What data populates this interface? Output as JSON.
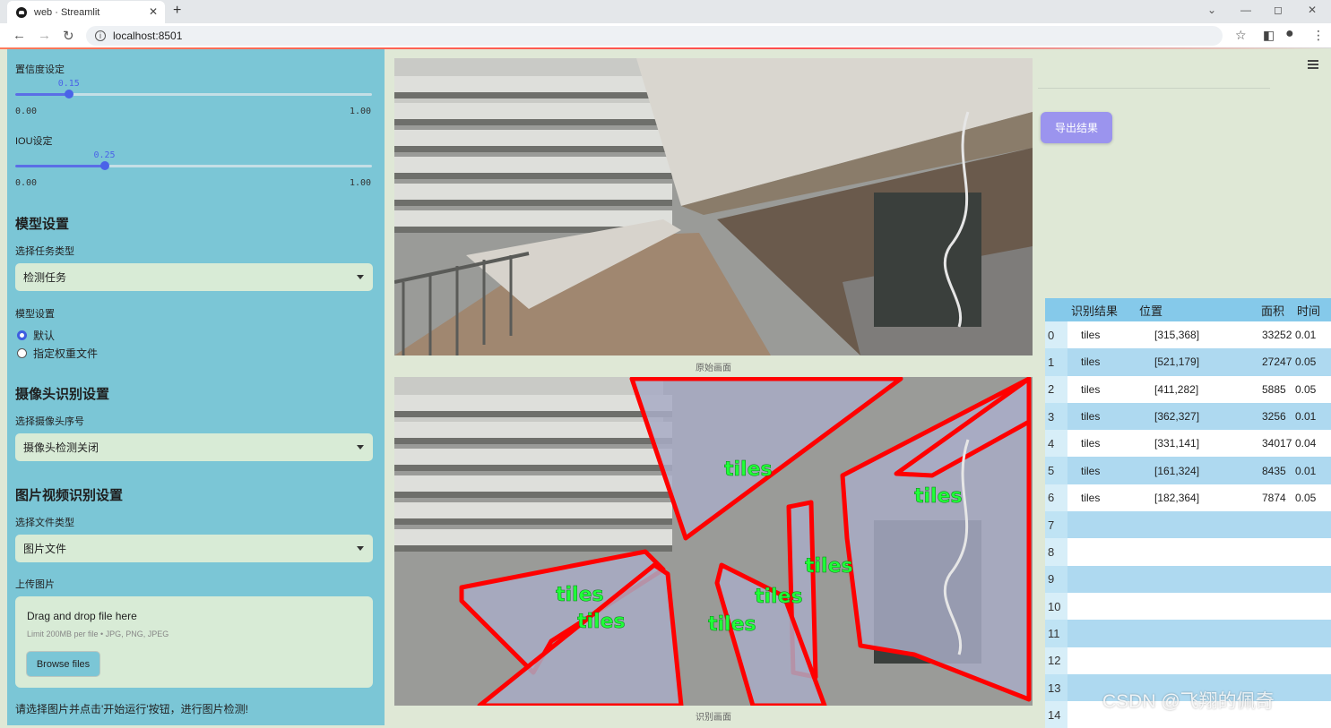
{
  "browser": {
    "tab_title": "web · Streamlit",
    "tab_close": "✕",
    "new_tab": "+",
    "url": "localhost:8501",
    "win_min": "—",
    "win_max": "◻",
    "win_close": "✕"
  },
  "sidebar": {
    "conf_label": "置信度设定",
    "conf_value": "0.15",
    "conf_fraction": 0.15,
    "conf_min": "0.00",
    "conf_max": "1.00",
    "iou_label": "IOU设定",
    "iou_value": "0.25",
    "iou_fraction": 0.25,
    "iou_min": "0.00",
    "iou_max": "1.00",
    "model_header": "模型设置",
    "task_type_label": "选择任务类型",
    "task_type_value": "检测任务",
    "model_setting_label": "模型设置",
    "radio_default": "默认",
    "radio_custom": "指定权重文件",
    "camera_header": "摄像头识别设置",
    "camera_label": "选择摄像头序号",
    "camera_value": "摄像头检测关闭",
    "media_header": "图片视频识别设置",
    "file_type_label": "选择文件类型",
    "file_type_value": "图片文件",
    "upload_label": "上传图片",
    "upload_drag": "Drag and drop file here",
    "upload_limit": "Limit 200MB per file • JPG, PNG, JPEG",
    "upload_button": "Browse files",
    "footer_hint": "请选择图片并点击'开始运行'按钮，进行图片检测!"
  },
  "main": {
    "caption_original": "原始画面",
    "caption_detected": "识别画面",
    "export_button": "导出结果",
    "detection_label": "tiles",
    "watermark": "CSDN @飞翔的佩奇"
  },
  "table": {
    "headers": [
      "",
      "识别结果",
      "位置",
      "面积",
      "时间"
    ],
    "rows": [
      {
        "idx": "0",
        "label": "tiles",
        "pos": "[315,368]",
        "area": "33252",
        "time": "0.01"
      },
      {
        "idx": "1",
        "label": "tiles",
        "pos": "[521,179]",
        "area": "27247",
        "time": "0.05"
      },
      {
        "idx": "2",
        "label": "tiles",
        "pos": "[411,282]",
        "area": "5885",
        "time": "0.05"
      },
      {
        "idx": "3",
        "label": "tiles",
        "pos": "[362,327]",
        "area": "3256",
        "time": "0.01"
      },
      {
        "idx": "4",
        "label": "tiles",
        "pos": "[331,141]",
        "area": "34017",
        "time": "0.04"
      },
      {
        "idx": "5",
        "label": "tiles",
        "pos": "[161,324]",
        "area": "8435",
        "time": "0.01"
      },
      {
        "idx": "6",
        "label": "tiles",
        "pos": "[182,364]",
        "area": "7874",
        "time": "0.05"
      }
    ],
    "empty_indices": [
      "7",
      "8",
      "9",
      "10",
      "11",
      "12",
      "13",
      "14"
    ]
  },
  "colors": {
    "sidebar_bg": "#7bc6d6",
    "main_bg": "#dfe8d6",
    "accent": "#4a63e8",
    "export_button": "#9b94ee",
    "mask_outline": "#ff0000",
    "label_green": "#20ff38"
  }
}
